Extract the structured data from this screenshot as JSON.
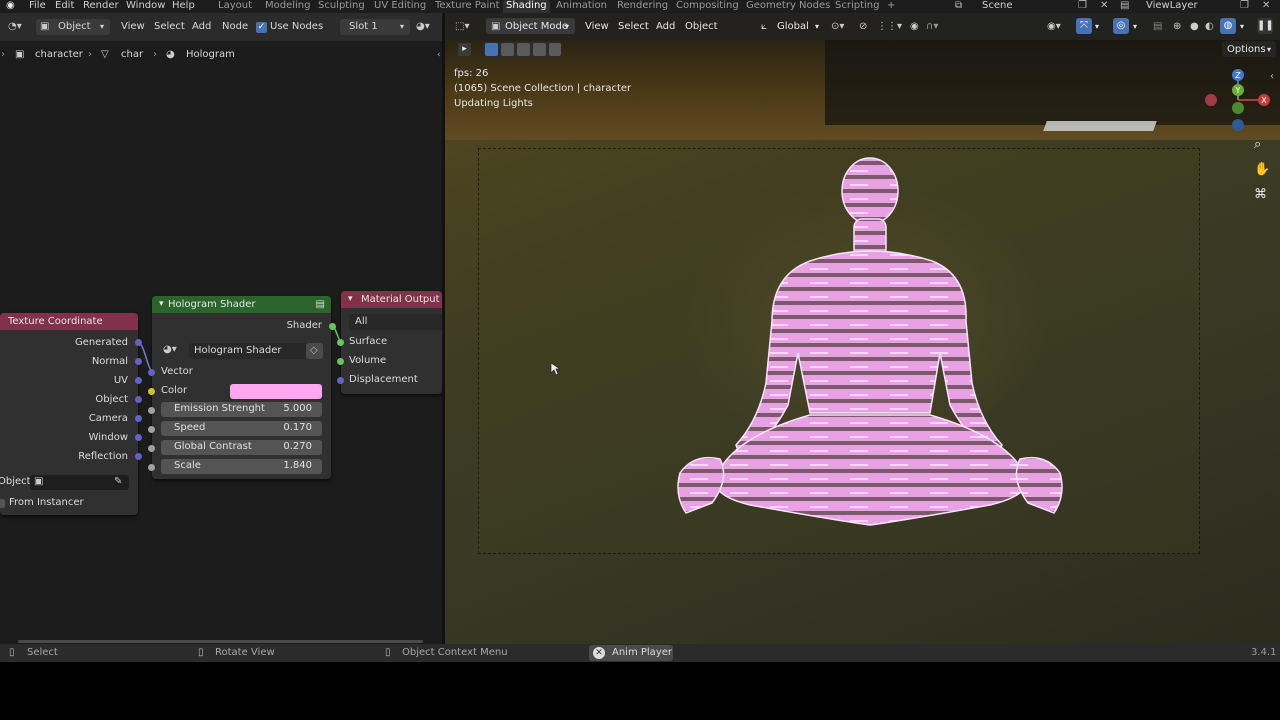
{
  "topbar": {
    "menus": [
      "File",
      "Edit",
      "Render",
      "Window",
      "Help"
    ],
    "workspaces": [
      "Layout",
      "Modeling",
      "Sculpting",
      "UV Editing",
      "Texture Paint",
      "Shading",
      "Animation",
      "Rendering",
      "Compositing",
      "Geometry Nodes",
      "Scripting"
    ],
    "active_workspace": "Shading",
    "add_tab": "+",
    "scene": "Scene",
    "view_layer": "ViewLayer"
  },
  "node_editor": {
    "header": {
      "object_mode": "Object",
      "view": "View",
      "select": "Select",
      "add": "Add",
      "node": "Node",
      "use_nodes": "Use Nodes",
      "slot": "Slot 1"
    },
    "breadcrumb": [
      "character",
      "char",
      "Hologram"
    ],
    "nodes": {
      "texture_coordinate": {
        "title": "Texture Coordinate",
        "outputs": [
          "Generated",
          "Normal",
          "UV",
          "Object",
          "Camera",
          "Window",
          "Reflection"
        ],
        "object_label": "Object:",
        "from_instancer": "From Instancer"
      },
      "hologram_shader": {
        "title": "Hologram Shader",
        "output": "Shader",
        "group_name": "Hologram Shader",
        "vector": "Vector",
        "color_label": "Color",
        "color_value": "#ffa6f0",
        "fields": [
          {
            "label": "Emission Strenght",
            "value": "5.000"
          },
          {
            "label": "Speed",
            "value": "0.170"
          },
          {
            "label": "Global Contrast",
            "value": "0.270"
          },
          {
            "label": "Scale",
            "value": "1.840"
          }
        ]
      },
      "material_output": {
        "title": "Material Output",
        "target": "All",
        "inputs": [
          "Surface",
          "Volume",
          "Displacement"
        ]
      }
    }
  },
  "viewport": {
    "header": {
      "mode": "Object Mode",
      "view": "View",
      "select": "Select",
      "add": "Add",
      "object": "Object",
      "orientation": "Global",
      "options": "Options"
    },
    "overlay": {
      "fps": "fps: 26",
      "collection": "(1065) Scene Collection | character",
      "status": "Updating Lights"
    },
    "gizmo": {
      "z": "Z",
      "y": "Y",
      "x": "X"
    }
  },
  "statusbar": {
    "select": "Select",
    "rotate": "Rotate View",
    "context": "Object Context Menu",
    "anim_player": "Anim Player",
    "version": "3.4.1"
  },
  "colors": {
    "tex_coord_header": "#83314a",
    "shader_header": "#2b652b",
    "output_header": "#83314a",
    "socket_vector": "#6363c7",
    "socket_shader": "#63c763",
    "socket_color": "#c7c729",
    "socket_float": "#a1a1a1",
    "hologram_pink": "#ff9bf0"
  }
}
